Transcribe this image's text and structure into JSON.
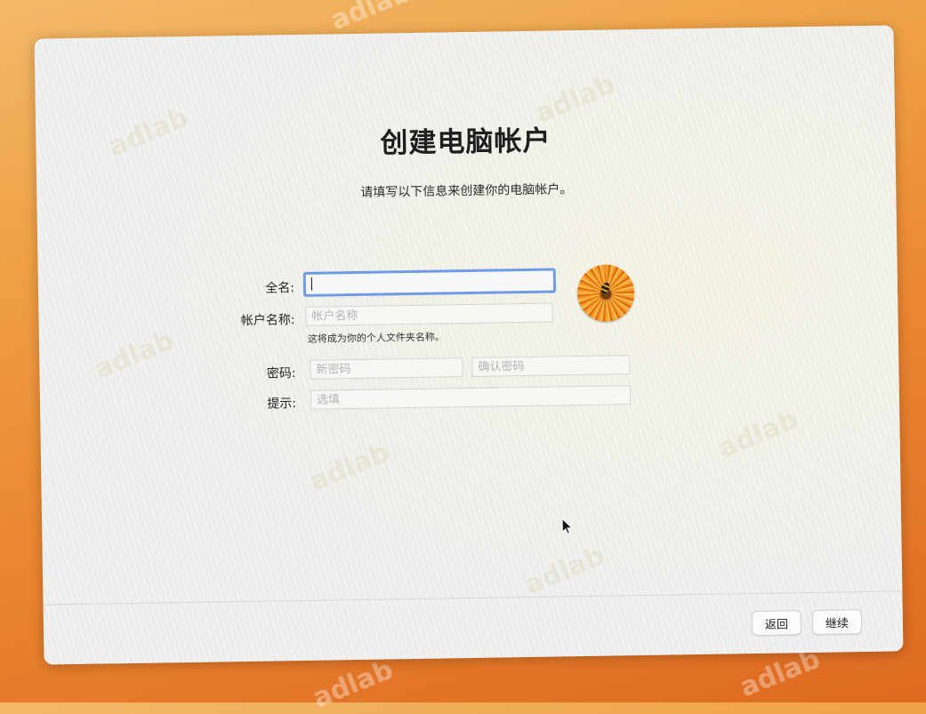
{
  "watermark_text": "adlab",
  "dialog": {
    "title": "创建电脑帐户",
    "subtitle": "请填写以下信息来创建你的电脑帐户。"
  },
  "form": {
    "full_name": {
      "label": "全名:",
      "value": ""
    },
    "account_name": {
      "label": "帐户名称:",
      "placeholder": "帐户名称",
      "hint": "这将成为你的个人文件夹名称。"
    },
    "password": {
      "label": "密码:",
      "placeholder": "新密码",
      "verify_placeholder": "确认密码"
    },
    "hint_field": {
      "label": "提示:",
      "placeholder": "选填"
    }
  },
  "avatar": {
    "icon": "flower-avatar-icon"
  },
  "buttons": {
    "back": "返回",
    "continue": "继续"
  }
}
